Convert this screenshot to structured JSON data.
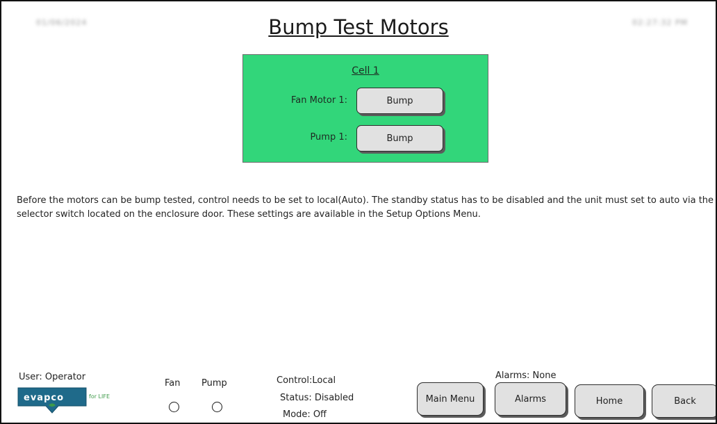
{
  "header": {
    "title": "Bump Test Motors",
    "date_text": "01/06/2024",
    "time_text": "02:27:32 PM"
  },
  "cell": {
    "title": "Cell 1",
    "fan_motor_label": "Fan Motor 1:",
    "fan_bump_label": "Bump",
    "pump_label": "Pump 1:",
    "pump_bump_label": "Bump",
    "panel_color": "#32d67a"
  },
  "instructions": {
    "text": "Before the motors can be bump tested, control needs to be set to local(Auto). The standby status has to be disabled and the unit must set to auto via the selector switch located on the enclosure door. These settings are available in the Setup Options Menu."
  },
  "footer": {
    "user_label": "User: Operator",
    "logo": {
      "brand": "evapco",
      "tagline": "for LIFE",
      "color": "#1f6a8a"
    },
    "indicators": {
      "fan_label": "Fan",
      "pump_label": "Pump",
      "fan_state": "off",
      "pump_state": "off"
    },
    "status": {
      "control_key": "Control:",
      "control_value": "Local",
      "status_key": "Status:",
      "status_value": "Disabled",
      "mode_key": "Mode:",
      "mode_value": "Off"
    },
    "alarms_summary": "Alarms: None",
    "nav": {
      "main_menu_label": "Main Menu",
      "alarms_label": "Alarms",
      "home_label": "Home",
      "back_label": "Back"
    }
  }
}
